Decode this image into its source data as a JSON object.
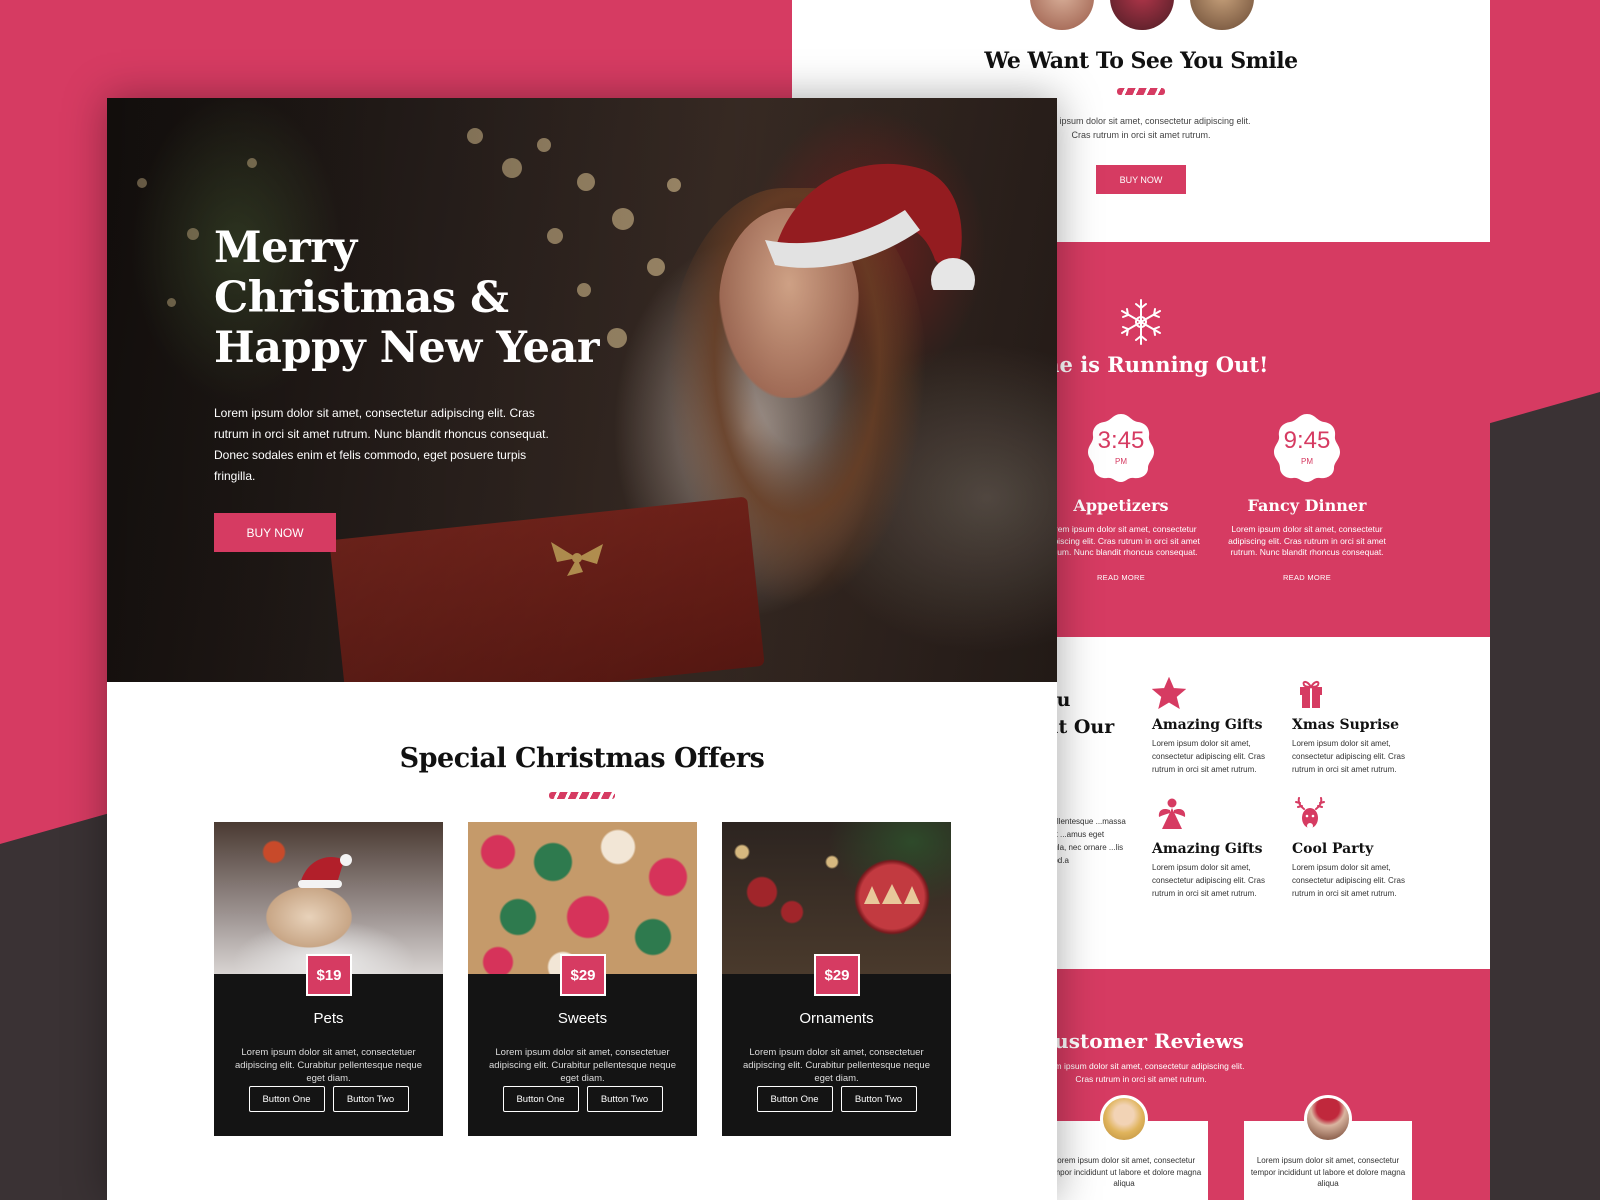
{
  "colors": {
    "accent": "#d63b62",
    "dark": "#3a3234",
    "card": "#141414"
  },
  "right_page": {
    "smile": {
      "title": "We Want To See You Smile",
      "text_line1": "Lorem ipsum dolor sit amet, consectetur adipiscing elit.",
      "text_line2": "Cras rutrum in orci sit amet rutrum.",
      "button": "BUY NOW"
    },
    "timing": {
      "title": "Time is Running Out!",
      "icon": "snowflake-icon",
      "items": [
        {
          "time": "3:45",
          "ampm": "PM",
          "title": "Appetizers",
          "text": "Lorem ipsum dolor sit amet, consectetur adipiscing elit. Cras rutrum in orci sit amet rutrum. Nunc blandit rhoncus consequat.",
          "link": "READ MORE"
        },
        {
          "time": "9:45",
          "ampm": "PM",
          "title": "Fancy Dinner",
          "text": "Lorem ipsum dolor sit amet, consectetur adipiscing elit. Cras rutrum in orci sit amet rutrum. Nunc blandit rhoncus consequat.",
          "link": "READ MORE"
        }
      ]
    },
    "features": {
      "title_line1": "You",
      "title_line2": "out Our",
      "side_text": "...it. Pellentesque ...massa nec est ...amus eget ...ehicula, nec ornare ...lis euismod.a",
      "items": [
        {
          "icon": "star-icon",
          "title": "Amazing Gifts",
          "text": "Lorem ipsum dolor sit amet, consectetur adipiscing elit. Cras rutrum in orci sit amet rutrum."
        },
        {
          "icon": "gift-icon",
          "title": "Xmas Suprise",
          "text": "Lorem ipsum dolor sit amet, consectetur adipiscing elit. Cras rutrum in orci sit amet rutrum."
        },
        {
          "icon": "angel-icon",
          "title": "Amazing Gifts",
          "text": "Lorem ipsum dolor sit amet, consectetur adipiscing elit. Cras rutrum in orci sit amet rutrum."
        },
        {
          "icon": "reindeer-icon",
          "title": "Cool Party",
          "text": "Lorem ipsum dolor sit amet, consectetur adipiscing elit. Cras rutrum in orci sit amet rutrum."
        }
      ]
    },
    "reviews": {
      "title": "Customer Reviews",
      "sub_line1": "Lorem ipsum dolor sit amet, consectetur adipiscing elit.",
      "sub_line2": "Cras rutrum in orci sit amet rutrum.",
      "items": [
        {
          "text": "Lorem ipsum dolor sit amet, consectetur tempor incididunt ut labore et dolore magna aliqua"
        },
        {
          "text": "Lorem ipsum dolor sit amet, consectetur tempor incididunt ut labore et dolore magna aliqua"
        }
      ]
    }
  },
  "hero": {
    "title_line1": "Merry",
    "title_line2": "Christmas &",
    "title_line3": "Happy New Year",
    "text": "Lorem ipsum dolor sit amet, consectetur adipiscing elit. Cras rutrum in orci sit amet rutrum. Nunc blandit rhoncus consequat. Donec sodales enim et felis commodo, eget posuere turpis fringilla.",
    "button": "BUY NOW"
  },
  "offers": {
    "title": "Special Christmas Offers",
    "items": [
      {
        "price": "$19",
        "name": "Pets",
        "text": "Lorem ipsum dolor sit amet, consectetuer adipiscing elit. Curabitur pellentesque neque eget diam.",
        "button_one": "Button One",
        "button_two": "Button Two"
      },
      {
        "price": "$29",
        "name": "Sweets",
        "text": "Lorem ipsum dolor sit amet, consectetuer adipiscing elit. Curabitur pellentesque neque eget diam.",
        "button_one": "Button One",
        "button_two": "Button Two"
      },
      {
        "price": "$29",
        "name": "Ornaments",
        "text": "Lorem ipsum dolor sit amet, consectetuer adipiscing elit. Curabitur pellentesque neque eget diam.",
        "button_one": "Button One",
        "button_two": "Button Two"
      }
    ]
  }
}
